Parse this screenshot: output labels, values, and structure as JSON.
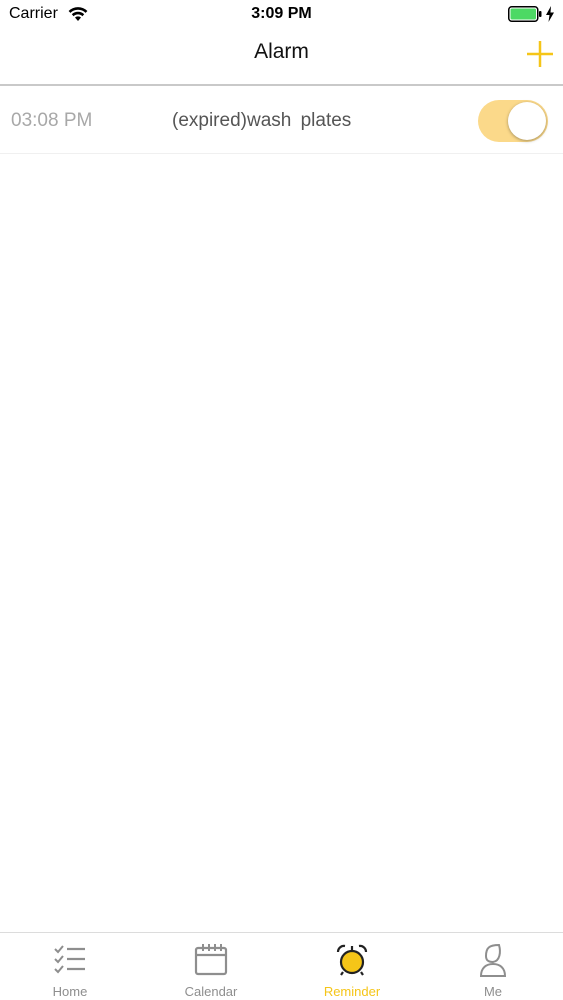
{
  "status_bar": {
    "carrier": "Carrier",
    "time": "3:09 PM",
    "wifi_icon": "wifi-icon",
    "battery_icon": "battery-charging-icon",
    "battery_color": "#4cd964"
  },
  "nav": {
    "title": "Alarm",
    "add_icon": "plus-icon",
    "accent": "#f5c518"
  },
  "alarms": [
    {
      "time": "03:08 PM",
      "label": "(expired)wash plates",
      "enabled": true,
      "toggle_color": "#fbd98a"
    }
  ],
  "tabs": [
    {
      "label": "Home",
      "icon": "checklist-icon",
      "active": false
    },
    {
      "label": "Calendar",
      "icon": "calendar-icon",
      "active": false
    },
    {
      "label": "Reminder",
      "icon": "alarm-clock-icon",
      "active": true
    },
    {
      "label": "Me",
      "icon": "person-icon",
      "active": false
    }
  ],
  "colors": {
    "active_tab": "#f5c518",
    "inactive_tab": "#8e8e8e"
  }
}
